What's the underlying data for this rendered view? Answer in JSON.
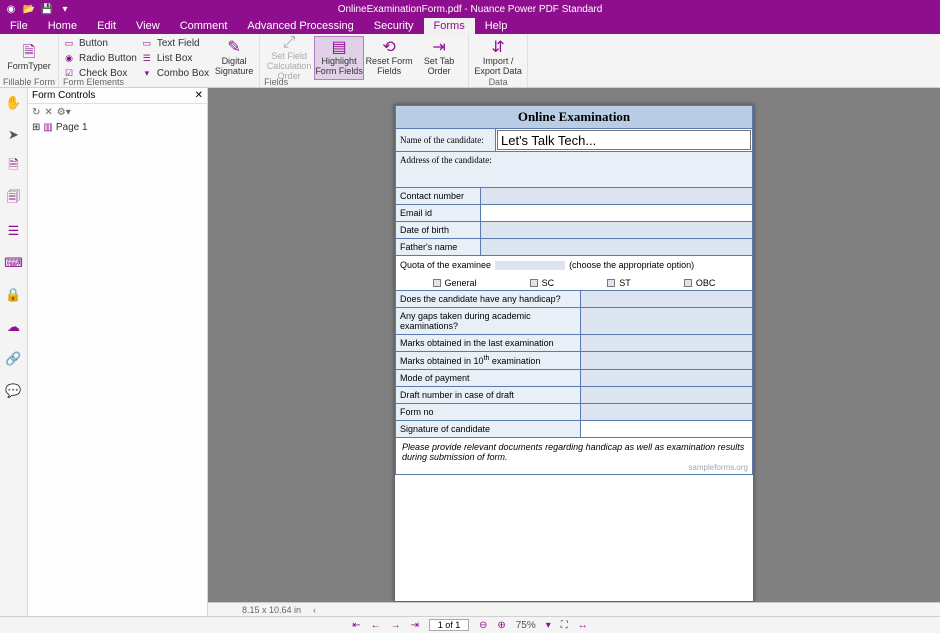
{
  "titlebar": {
    "title": "OnlineExaminationForm.pdf - Nuance Power PDF Standard"
  },
  "menu": {
    "items": [
      "File",
      "Home",
      "Edit",
      "View",
      "Comment",
      "Advanced Processing",
      "Security",
      "Forms",
      "Help"
    ],
    "active": "Forms"
  },
  "ribbon": {
    "fillable": {
      "label": "Fillable Form",
      "btn": "FormTyper"
    },
    "elements": {
      "label": "Form Elements",
      "small1": [
        "Button",
        "Radio Button",
        "Check Box"
      ],
      "small2": [
        "Text Field",
        "List Box",
        "Combo Box"
      ],
      "digital": "Digital\nSignature"
    },
    "fields": {
      "label": "Fields",
      "b1": "Set Field\nCalculation Order",
      "b2": "Highlight\nForm Fields",
      "b3": "Reset Form\nFields",
      "b4": "Set Tab\nOrder"
    },
    "data": {
      "label": "Data",
      "btn": "Import /\nExport Data"
    }
  },
  "panel": {
    "title": "Form Controls",
    "page": "Page 1"
  },
  "form": {
    "title": "Online Examination",
    "name_label": "Name of the candidate:",
    "name_value": "Let's Talk Tech...",
    "address_label": "Address of the candidate:",
    "rows1": [
      "Contact number",
      "Email id",
      "Date of birth",
      "Father's name"
    ],
    "quota_text": "Quota of the examinee",
    "quota_hint": "(choose the appropriate option)",
    "opts": [
      "General",
      "SC",
      "ST",
      "OBC"
    ],
    "rows2": [
      "Does the candidate have any handicap?",
      "Any gaps taken during academic examinations?",
      "Marks obtained in the last examination"
    ],
    "marks10_a": "Marks obtained in 10",
    "marks10_b": " examination",
    "rows3": [
      "Mode of payment",
      "Draft number in case of draft",
      "Form no",
      "Signature of candidate"
    ],
    "footer": "Please provide relevant documents regarding handicap as well as examination results during submission of form.",
    "watermark": "sampleforms.org"
  },
  "ruler": {
    "dims": "8.15 x 10.64 in"
  },
  "status": {
    "page": "1 of 1",
    "zoom": "75%"
  }
}
